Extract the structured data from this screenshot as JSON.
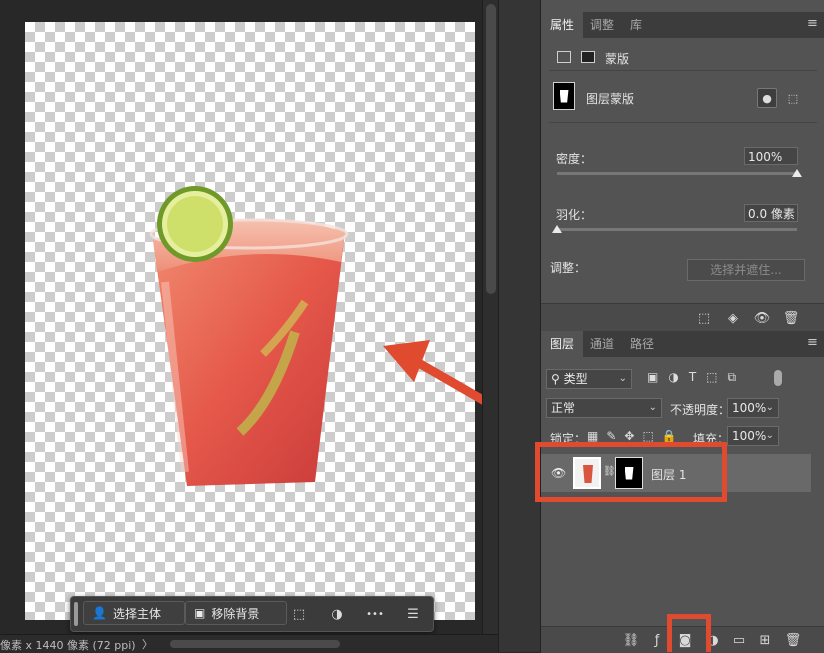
{
  "status_bar": {
    "text": "像素 x 1440 像素 (72 ppi)",
    "arrow": "〉"
  },
  "task_bar": {
    "select_subject": "选择主体",
    "remove_background": "移除背景",
    "more": "•••"
  },
  "properties_panel": {
    "tabs": [
      "属性",
      "调整",
      "库"
    ],
    "mask_label": "蒙版",
    "layer_mask_label": "图层蒙版",
    "density_label": "密度：",
    "density_value": "100%",
    "density_level": 1.0,
    "feather_label": "羽化：",
    "feather_value": "0.0 像素",
    "feather_level": 0.0,
    "adjust_label": "调整：",
    "select_and_mask_button": "选择并遮住..."
  },
  "layers_panel": {
    "tabs": [
      "图层",
      "通道",
      "路径"
    ],
    "filter_type": "类型",
    "blend_mode": "正常",
    "opacity_label": "不透明度：",
    "opacity_value": "100%",
    "lock_label": "锁定：",
    "fill_label": "填充：",
    "fill_value": "100%",
    "layer_name": "图层 1"
  },
  "colors": {
    "annotation_red": "#e04a2f",
    "panel_bg": "#535353",
    "canvas_bg": "#282828"
  }
}
